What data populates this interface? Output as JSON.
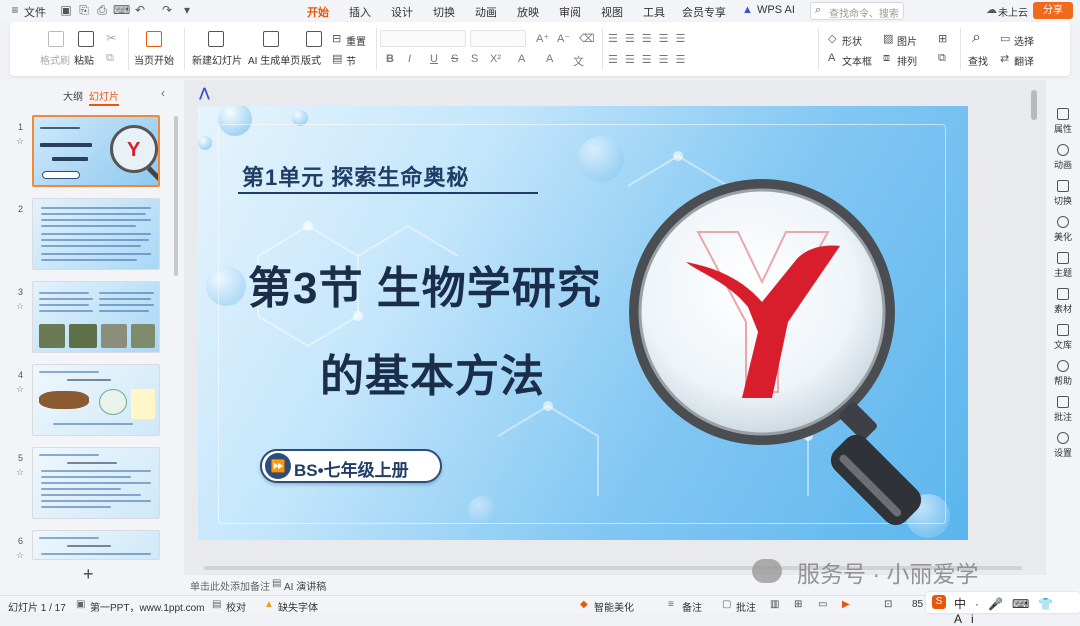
{
  "menubar": {
    "file": "文件",
    "tabs": [
      "开始",
      "插入",
      "设计",
      "切换",
      "动画",
      "放映",
      "审阅",
      "视图",
      "工具",
      "会员专享"
    ],
    "active_tab": "开始",
    "wps_ai": "WPS AI",
    "search_placeholder": "查找命令、搜索模板",
    "cloud": "未上云",
    "share": "分享"
  },
  "ribbon": {
    "format_painter": "格式刷",
    "paste": "粘贴",
    "play_from_current": "当页开始",
    "new_slide": "新建幻灯片",
    "ai_single_page": "AI 生成单页",
    "layout": "版式",
    "reset": "重置",
    "section": "节",
    "shape": "形状",
    "picture": "图片",
    "select": "选择",
    "textbox": "文本框",
    "arrange": "排列",
    "find": "查找",
    "translate": "翻译",
    "format_row1": [
      "A⁺",
      "A⁻",
      "⌫"
    ],
    "format_row2": [
      "B",
      "I",
      "U",
      "S",
      "S",
      "X²",
      "A",
      "A",
      "文"
    ]
  },
  "left_panel": {
    "tab_outline": "大纲",
    "tab_slides": "幻灯片",
    "slide_numbers": [
      "1",
      "2",
      "3",
      "4",
      "5",
      "6"
    ],
    "add": "+"
  },
  "slide": {
    "unit": "第1单元  探索生命奥秘",
    "title_line1": "第3节 生物学研究",
    "title_line2": "的基本方法",
    "badge": "BS•七年级上册"
  },
  "right_panel": [
    "属性",
    "动画",
    "切换",
    "美化",
    "主题",
    "素材",
    "文库",
    "帮助",
    "批注",
    "设置"
  ],
  "notes": {
    "placeholder": "单击此处添加备注",
    "ai_speech": "AI 演讲稿"
  },
  "status": {
    "slide_count": "幻灯片 1 / 17",
    "theme": "第一PPT，www.1ppt.com",
    "proofread": "校对",
    "missing_font": "缺失字体",
    "beautify": "智能美化",
    "notes": "备注",
    "comments": "批注",
    "zoom": "85"
  },
  "watermark": "服务号 · 小丽爱学",
  "colors": {
    "accent": "#e8580c",
    "slide_title": "#1a2e4a",
    "logo_red": "#d81e2c"
  }
}
